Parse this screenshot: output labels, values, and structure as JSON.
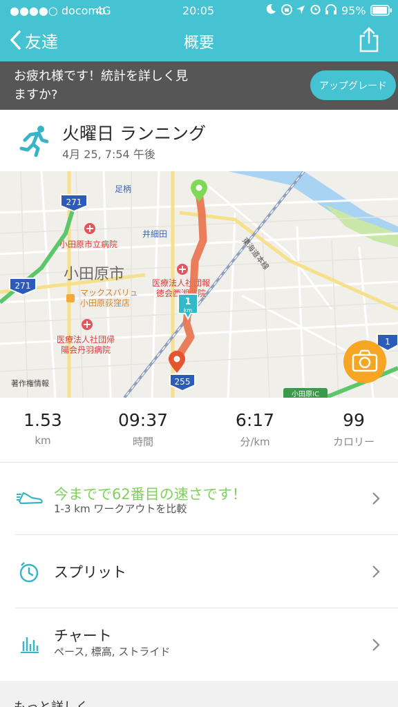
{
  "status_bar": {
    "carrier": "●●●●○ docomo",
    "network": "4G",
    "time": "20:05",
    "battery": "95%"
  },
  "nav": {
    "back_label": "友達",
    "title": "概要"
  },
  "banner": {
    "message": "お疲れ様です！統計を詳しく見ますか?",
    "upgrade_label": "アップグレード"
  },
  "workout": {
    "title": "火曜日 ランニング",
    "datetime": "4月 25, 7:54 午後"
  },
  "map": {
    "labels": {
      "city": "小田原市",
      "station_ashigara": "足柄",
      "station_iseda": "井細田",
      "hospital_city": "小田原市立病院",
      "hospital_toku_line1": "医療法人社団報",
      "hospital_toku_line2": "徳会西湘病院",
      "store_line1": "マックスバリュ",
      "store_line2": "小田原荻窪店",
      "hospital_niba_line1": "医療法人社団帰",
      "hospital_niba_line2": "陽会丹羽病院",
      "rail_line": "東海道本線",
      "copyright": "著作権情報",
      "ic_sign": "小田原IC",
      "route_271_top": "271",
      "route_271_left": "271",
      "route_255": "255",
      "route_1": "1",
      "km_marker": "1",
      "km_unit": "km"
    },
    "colors": {
      "route": "#e8734f",
      "start_pin": "#7ed957",
      "end_pin": "#e5532f",
      "km_marker": "#35b8c8",
      "camera": "#f6a623"
    }
  },
  "stats": [
    {
      "value": "1.53",
      "unit": "km"
    },
    {
      "value": "09:37",
      "unit": "時間"
    },
    {
      "value": "6:17",
      "unit": "分/km"
    },
    {
      "value": "99",
      "unit": "カロリー"
    }
  ],
  "rows": {
    "compare_title": "今までで62番目の速さです！",
    "compare_subtitle": "1-3 km ワークアウトを比較",
    "splits_title": "スプリット",
    "chart_title": "チャート",
    "chart_subtitle": "ペース, 標高, ストライド"
  },
  "more_label": "もっと詳しく",
  "colors": {
    "accent": "#45c3d3",
    "compare_green": "#7ed15d",
    "banner_bg": "#565656"
  },
  "icons": [
    "back-chevron-icon",
    "share-icon",
    "runner-icon",
    "camera-icon",
    "shoe-icon",
    "stopwatch-icon",
    "bar-chart-icon",
    "chevron-right-icon"
  ]
}
